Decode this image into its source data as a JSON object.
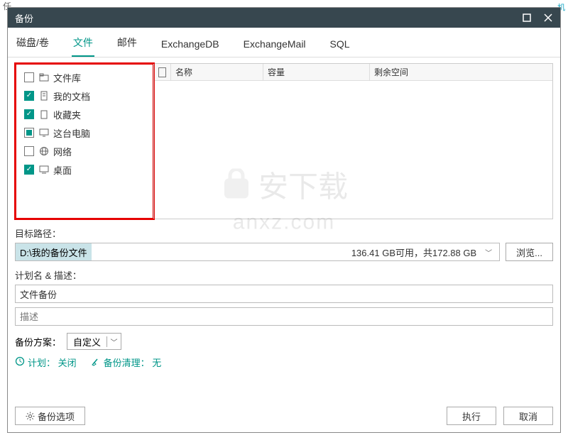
{
  "titlebar": {
    "title": "备份"
  },
  "tabs": [
    "磁盘/卷",
    "文件",
    "邮件",
    "ExchangeDB",
    "ExchangeMail",
    "SQL"
  ],
  "active_tab_index": 1,
  "tree": [
    {
      "checked": "unchecked",
      "icon": "folder",
      "label": "文件库"
    },
    {
      "checked": "checked",
      "icon": "doc",
      "label": "我的文档"
    },
    {
      "checked": "checked",
      "icon": "star",
      "label": "收藏夹"
    },
    {
      "checked": "partial",
      "icon": "pc",
      "label": "这台电脑"
    },
    {
      "checked": "unchecked",
      "icon": "net",
      "label": "网络"
    },
    {
      "checked": "checked",
      "icon": "desk",
      "label": "桌面"
    }
  ],
  "list_columns": [
    "名称",
    "容量",
    "剩余空间"
  ],
  "labels": {
    "target_path": "目标路径：",
    "plan_desc": "计划名 & 描述：",
    "scheme": "备份方案：",
    "browse": "浏览...",
    "options": "备份选项",
    "execute": "执行",
    "cancel": "取消",
    "plan_label": "计划：",
    "plan_value": "关闭",
    "cleanup_label": "备份清理：",
    "cleanup_value": "无"
  },
  "path": {
    "value": "D:\\我的备份文件",
    "info": "136.41 GB可用，共172.88 GB"
  },
  "inputs": {
    "name_value": "文件备份",
    "desc_placeholder": "描述"
  },
  "scheme_value": "自定义",
  "bg_hint": "任",
  "bg_right": "机",
  "watermark": {
    "line1": "安下载",
    "line2": "anxz.com"
  }
}
